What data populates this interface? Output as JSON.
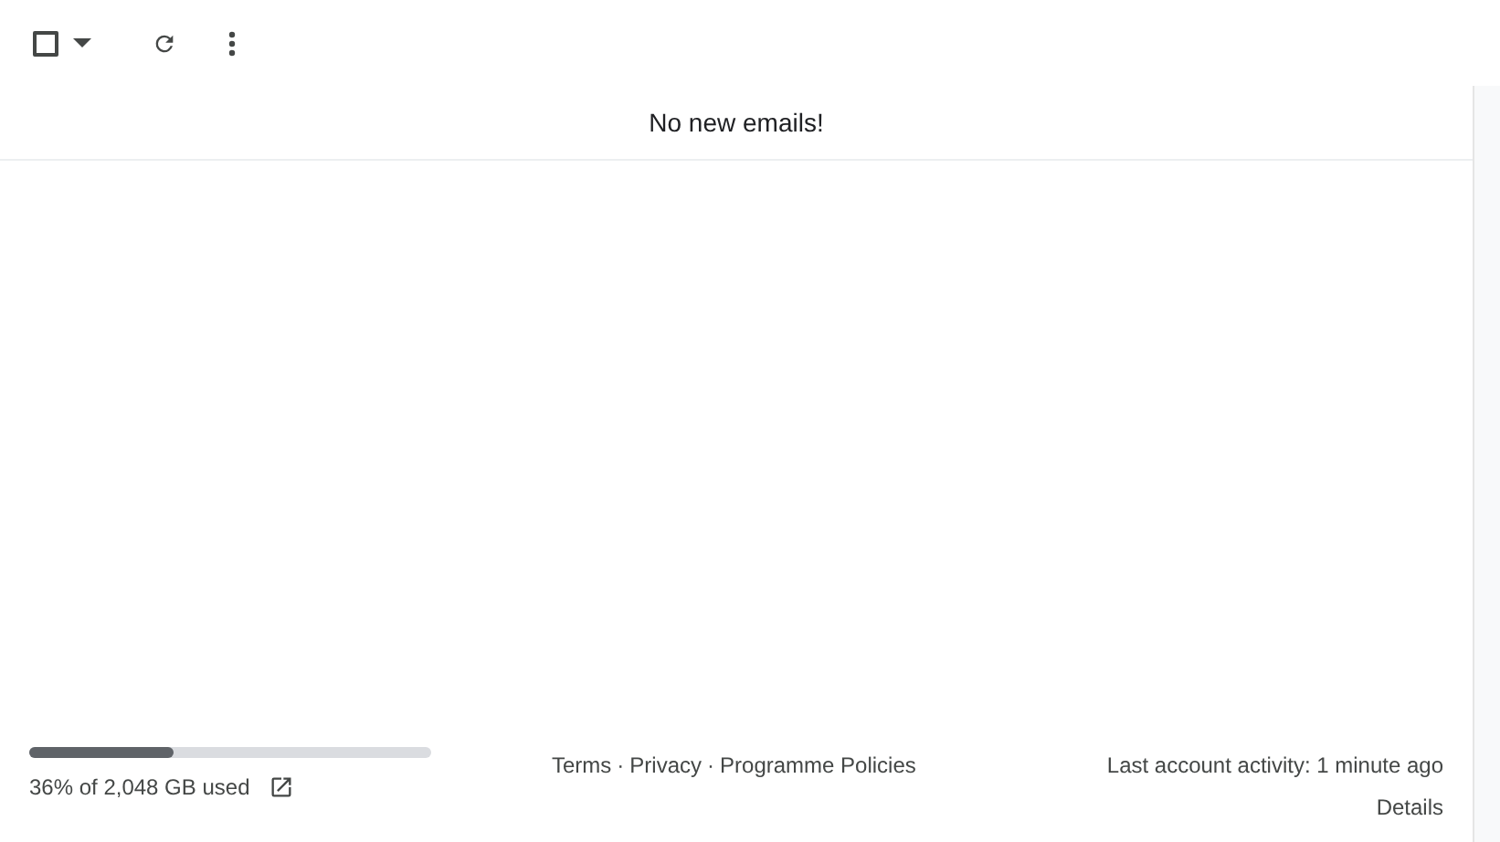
{
  "toolbar": {
    "select_checked": false
  },
  "message": "No new emails!",
  "storage": {
    "level": 0.36,
    "label": "36% of 2,048 GB used"
  },
  "footer_links": [
    "Terms",
    "Privacy",
    "Programme Policies"
  ],
  "separator": "·",
  "activity": {
    "text": "Last account activity: 1 minute ago",
    "link": "Details"
  }
}
